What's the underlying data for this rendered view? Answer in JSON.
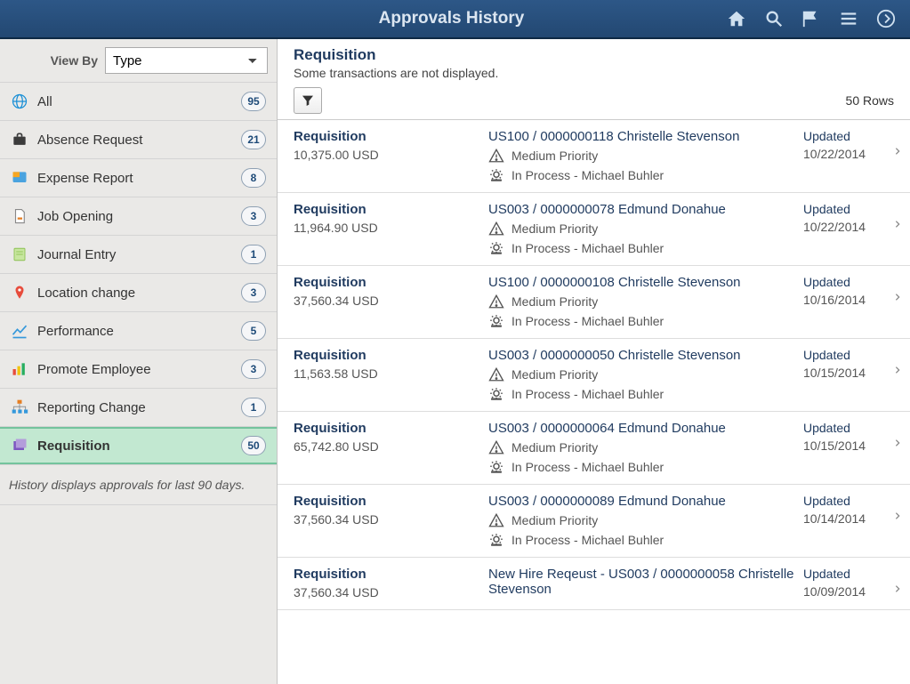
{
  "header": {
    "title": "Approvals History"
  },
  "sidebar": {
    "viewby_label": "View By",
    "viewby_value": "Type",
    "footer": "History displays approvals for last 90 days.",
    "items": [
      {
        "label": "All",
        "count": "95",
        "icon": "globe",
        "color": "#1a8fd6"
      },
      {
        "label": "Absence Request",
        "count": "21",
        "icon": "suitcase",
        "color": "#3b3b3b"
      },
      {
        "label": "Expense Report",
        "count": "8",
        "icon": "receipt",
        "color": "#f6a623"
      },
      {
        "label": "Job Opening",
        "count": "3",
        "icon": "page",
        "color": "#8a8a8a"
      },
      {
        "label": "Journal Entry",
        "count": "1",
        "icon": "note",
        "color": "#8cc152"
      },
      {
        "label": "Location change",
        "count": "3",
        "icon": "pin",
        "color": "#e74c3c"
      },
      {
        "label": "Performance",
        "count": "5",
        "icon": "chart",
        "color": "#3498db"
      },
      {
        "label": "Promote Employee",
        "count": "3",
        "icon": "bars",
        "color": "#27ae60"
      },
      {
        "label": "Reporting Change",
        "count": "1",
        "icon": "org",
        "color": "#e67e22"
      },
      {
        "label": "Requisition",
        "count": "50",
        "icon": "stack",
        "color": "#7d57c1",
        "selected": true
      }
    ]
  },
  "content": {
    "title": "Requisition",
    "subtitle": "Some transactions are not displayed.",
    "rows_label": "50 Rows"
  },
  "rows": [
    {
      "type": "Requisition",
      "amount": "10,375.00 USD",
      "id": "US100 / 0000000118 Christelle Stevenson",
      "priority": "Medium Priority",
      "process": "In Process - Michael Buhler",
      "status": "Updated",
      "date": "10/22/2014"
    },
    {
      "type": "Requisition",
      "amount": "11,964.90 USD",
      "id": "US003 / 0000000078 Edmund Donahue",
      "priority": "Medium Priority",
      "process": "In Process - Michael Buhler",
      "status": "Updated",
      "date": "10/22/2014"
    },
    {
      "type": "Requisition",
      "amount": "37,560.34 USD",
      "id": "US100 / 0000000108 Christelle Stevenson",
      "priority": "Medium Priority",
      "process": "In Process - Michael Buhler",
      "status": "Updated",
      "date": "10/16/2014"
    },
    {
      "type": "Requisition",
      "amount": "11,563.58 USD",
      "id": "US003 / 0000000050 Christelle Stevenson",
      "priority": "Medium Priority",
      "process": "In Process - Michael Buhler",
      "status": "Updated",
      "date": "10/15/2014"
    },
    {
      "type": "Requisition",
      "amount": "65,742.80 USD",
      "id": "US003 / 0000000064 Edmund Donahue",
      "priority": "Medium Priority",
      "process": "In Process - Michael Buhler",
      "status": "Updated",
      "date": "10/15/2014"
    },
    {
      "type": "Requisition",
      "amount": "37,560.34 USD",
      "id": "US003 / 0000000089 Edmund Donahue",
      "priority": "Medium Priority",
      "process": "In Process - Michael Buhler",
      "status": "Updated",
      "date": "10/14/2014"
    },
    {
      "type": "Requisition",
      "amount": "37,560.34 USD",
      "id": "New Hire Reqeust - US003 / 0000000058 Christelle Stevenson",
      "priority": "",
      "process": "",
      "status": "Updated",
      "date": "10/09/2014"
    }
  ]
}
